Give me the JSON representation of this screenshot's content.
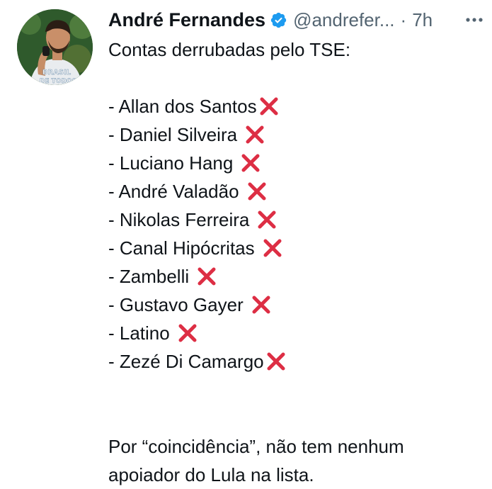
{
  "author": {
    "display_name": "André Fernandes",
    "handle": "@andrefer...",
    "separator": "·",
    "time": "7h",
    "avatar_text_line1": "BRASIL",
    "avatar_text_line2": "DE TODOS",
    "verified_icon": "verified-badge-icon"
  },
  "tweet": {
    "intro": "Contas derrubadas pelo TSE:",
    "accounts": [
      {
        "name": "- Allan dos Santos"
      },
      {
        "name": "- Daniel Silveira"
      },
      {
        "name": "- Luciano Hang"
      },
      {
        "name": "- André Valadão"
      },
      {
        "name": "- Nikolas Ferreira"
      },
      {
        "name": "- Canal Hipócritas"
      },
      {
        "name": "- Zambelli"
      },
      {
        "name": "- Gustavo Gayer"
      },
      {
        "name": "- Latino"
      },
      {
        "name": "- Zezé Di Camargo"
      }
    ],
    "outro_line1": "Por “coincidência”, não tem nenhum",
    "outro_line2": "apoiador do Lula na lista."
  },
  "colors": {
    "cross": "#dd2e44",
    "verified": "#1d9bf0",
    "secondary_text": "#536471",
    "primary_text": "#0f1419"
  }
}
